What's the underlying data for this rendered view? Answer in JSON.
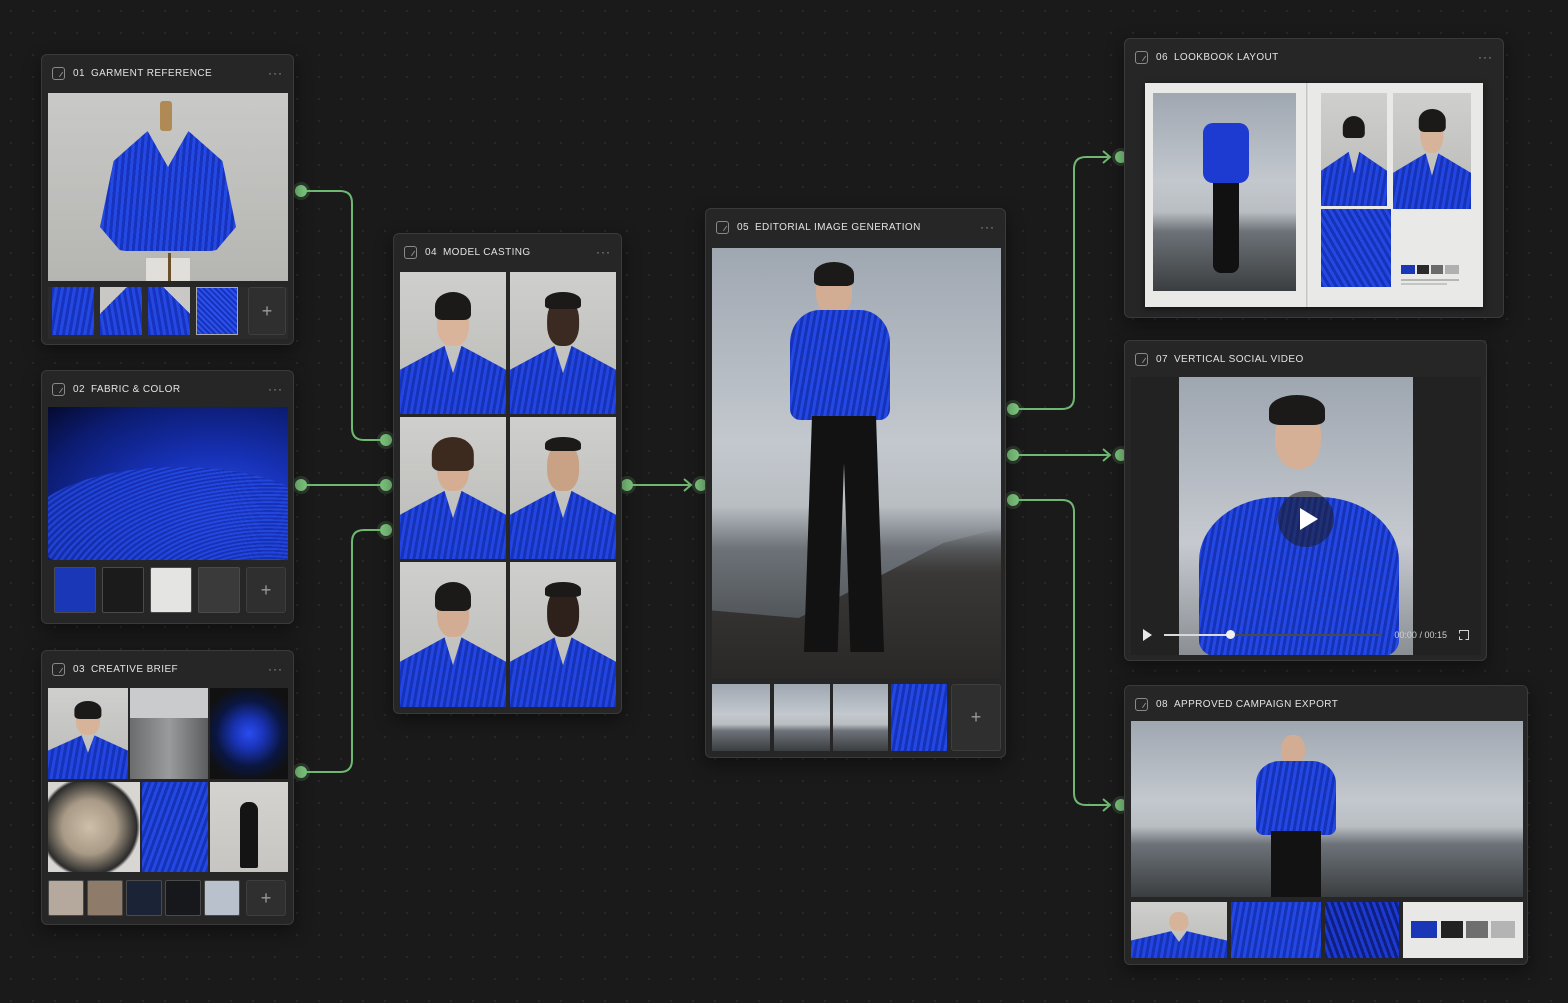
{
  "colors": {
    "accent": "#7dc67e",
    "canvas": "#1a1a1a",
    "node_bg": "#262626",
    "brand_blue": "#1d3bd0"
  },
  "nodes": {
    "garment": {
      "num": "01",
      "title": "GARMENT REFERENCE",
      "icon": "image-node-icon"
    },
    "fabric": {
      "num": "02",
      "title": "FABRIC & COLOR",
      "icon": "image-node-icon",
      "swatches": [
        "#1a37b8",
        "#1b1b1b",
        "#e4e4e2",
        "#3a3a3a"
      ]
    },
    "brief": {
      "num": "03",
      "title": "CREATIVE BRIEF",
      "icon": "image-node-icon",
      "swatches": [
        "#b4a99c",
        "#8e7b69",
        "#1a2436",
        "#16181c",
        "#b9c2cc"
      ]
    },
    "casting": {
      "num": "04",
      "title": "MODEL CASTING",
      "icon": "image-node-icon"
    },
    "editorial": {
      "num": "05",
      "title": "EDITORIAL IMAGE GENERATION",
      "icon": "generate-node-icon"
    },
    "lookbook": {
      "num": "06",
      "title": "LOOKBOOK LAYOUT",
      "icon": "layout-node-icon",
      "swatches": [
        "#1a37b8",
        "#2a2a2a",
        "#6a6a6a",
        "#b0b0b0"
      ]
    },
    "video": {
      "num": "07",
      "title": "VERTICAL SOCIAL VIDEO",
      "icon": "video-node-icon",
      "current_time": "00:00",
      "separator": "/",
      "duration": "00:15",
      "progress": 0.3
    },
    "export": {
      "num": "08",
      "title": "APPROVED CAMPAIGN EXPORT",
      "icon": "export-node-icon",
      "swatches": [
        "#1a37b8",
        "#222222",
        "#6e6e6e",
        "#b4b4b4"
      ]
    }
  },
  "more_label": "···",
  "add_label": "+"
}
